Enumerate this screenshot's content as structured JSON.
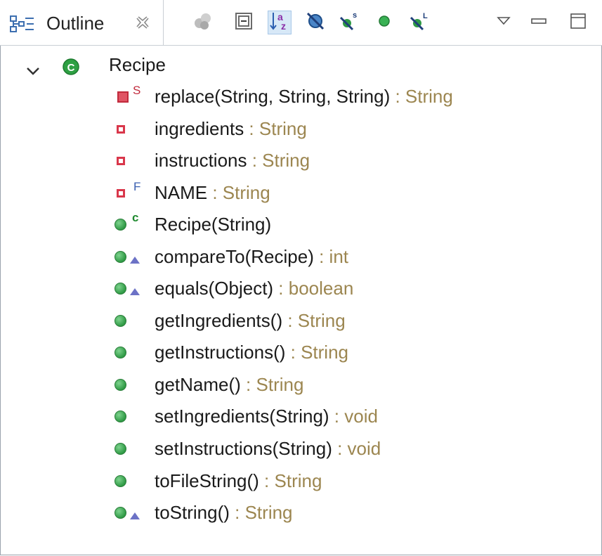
{
  "view": {
    "tab_title": "Outline",
    "toolbar": [
      {
        "name": "hide-non-public-members-icon"
      },
      {
        "name": "collapse-all-icon"
      },
      {
        "name": "sort-alphabetically-icon"
      },
      {
        "name": "hide-fields-icon"
      },
      {
        "name": "hide-static-members-icon"
      },
      {
        "name": "hide-non-public-icon"
      },
      {
        "name": "hide-local-types-icon"
      },
      {
        "name": "view-menu-icon"
      },
      {
        "name": "minimize-icon"
      },
      {
        "name": "maximize-icon"
      }
    ]
  },
  "tree": {
    "root": {
      "label": "Recipe",
      "icon": "class-icon",
      "expanded": true
    },
    "members": [
      {
        "name": "replace(String, String, String)",
        "sep": " : ",
        "type": "String",
        "icon": "private-static-method-icon",
        "badge": "S"
      },
      {
        "name": "ingredients",
        "sep": " : ",
        "type": "String",
        "icon": "private-field-icon",
        "badge": ""
      },
      {
        "name": "instructions",
        "sep": " : ",
        "type": "String",
        "icon": "private-field-icon",
        "badge": ""
      },
      {
        "name": "NAME",
        "sep": " : ",
        "type": "String",
        "icon": "private-final-field-icon",
        "badge": "F"
      },
      {
        "name": "Recipe(String)",
        "sep": "",
        "type": "",
        "icon": "public-constructor-icon",
        "badge": "c"
      },
      {
        "name": "compareTo(Recipe)",
        "sep": " : ",
        "type": "int",
        "icon": "public-override-method-icon",
        "badge": ""
      },
      {
        "name": "equals(Object)",
        "sep": " : ",
        "type": "boolean",
        "icon": "public-override-method-icon",
        "badge": ""
      },
      {
        "name": "getIngredients()",
        "sep": " : ",
        "type": "String",
        "icon": "public-method-icon",
        "badge": ""
      },
      {
        "name": "getInstructions()",
        "sep": " : ",
        "type": "String",
        "icon": "public-method-icon",
        "badge": ""
      },
      {
        "name": "getName()",
        "sep": " : ",
        "type": "String",
        "icon": "public-method-icon",
        "badge": ""
      },
      {
        "name": "setIngredients(String)",
        "sep": " : ",
        "type": "void",
        "icon": "public-method-icon",
        "badge": ""
      },
      {
        "name": "setInstructions(String)",
        "sep": " : ",
        "type": "void",
        "icon": "public-method-icon",
        "badge": ""
      },
      {
        "name": "toFileString()",
        "sep": " : ",
        "type": "String",
        "icon": "public-method-icon",
        "badge": ""
      },
      {
        "name": "toString()",
        "sep": " : ",
        "type": "String",
        "icon": "public-override-method-icon",
        "badge": ""
      }
    ]
  },
  "colors": {
    "type_text": "#9c8650",
    "public_member": "#2f9a45",
    "private_member": "#d9374b",
    "static_badge": "#c12a3c",
    "final_badge": "#3a5fb0",
    "constructor_badge": "#1f8a2f",
    "override_marker": "#6c72c6"
  }
}
